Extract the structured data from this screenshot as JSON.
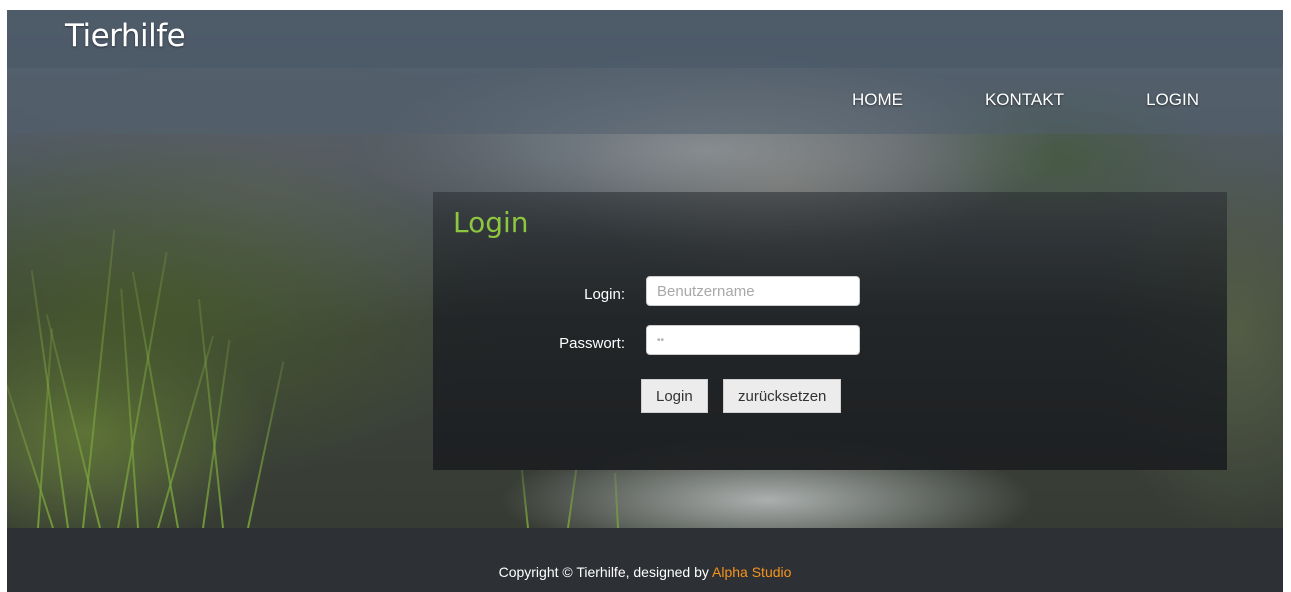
{
  "header": {
    "site_title": "Tierhilfe",
    "nav": [
      {
        "label": "HOME"
      },
      {
        "label": "KONTAKT"
      },
      {
        "label": "LOGIN"
      }
    ]
  },
  "login": {
    "heading": "Login",
    "username_label": "Login:",
    "username_placeholder": "Benutzername",
    "username_value": "",
    "password_label": "Passwort:",
    "password_value": "••",
    "submit_label": "Login",
    "reset_label": "zurücksetzen"
  },
  "footer": {
    "copyright_text": "Copyright © Tierhilfe, designed by ",
    "designer_link": "Alpha Studio"
  },
  "colors": {
    "heading_green": "#8dc63f",
    "footer_link_orange": "#f7941d",
    "footer_bg": "#2d3034"
  }
}
